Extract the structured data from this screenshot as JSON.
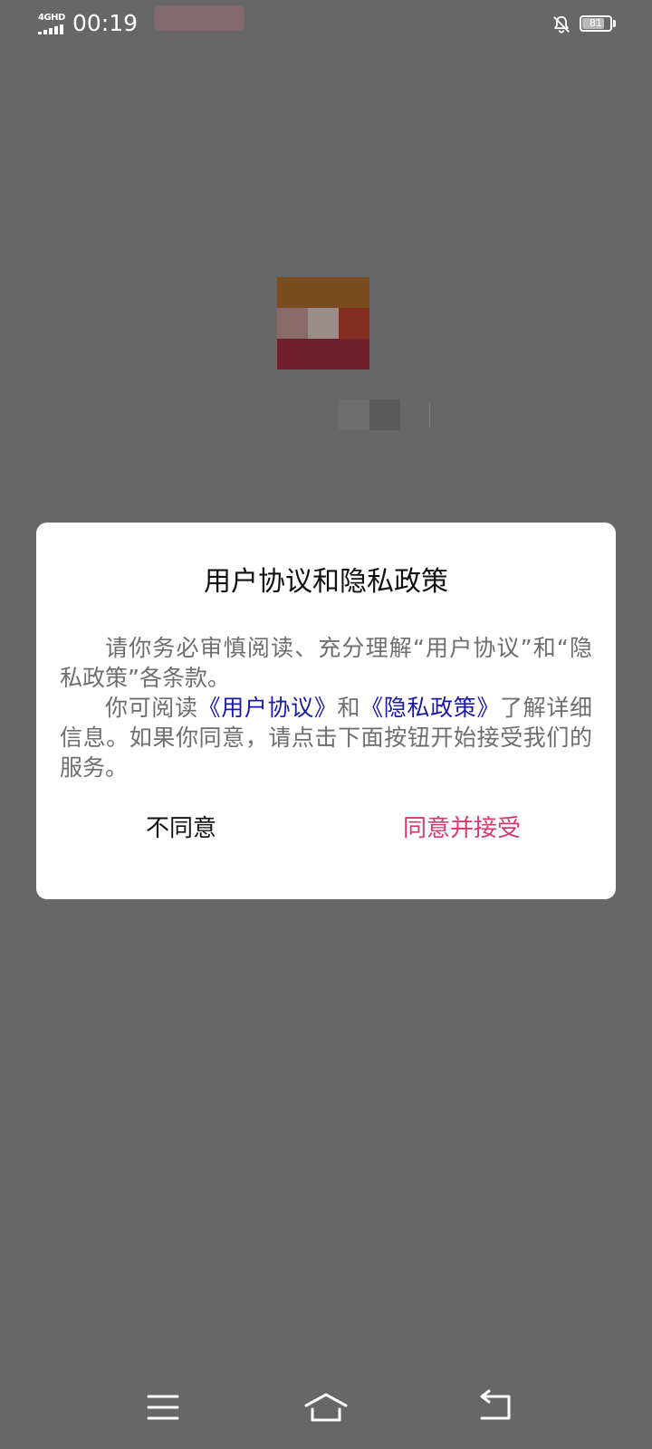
{
  "status_bar": {
    "network": "4GHD",
    "time": "00:19",
    "battery_level": 81,
    "icons": [
      "signal-icon",
      "bell-off-icon",
      "battery-icon"
    ]
  },
  "dialog": {
    "title": "用户协议和隐私政策",
    "paragraph1": "请你务必审慎阅读、充分理解“用户协议”和“隐私政策”各条款。",
    "paragraph2_prefix": "你可阅读",
    "user_agreement_link": "《用户协议》",
    "paragraph2_and": "和",
    "privacy_policy_link": "《隐私政策》",
    "paragraph2_suffix": "了解详细信息。如果你同意，请点击下面按钮开始接受我们的服务。",
    "disagree_label": "不同意",
    "agree_label": "同意并接受"
  },
  "navigation": {
    "icons": [
      "menu-icon",
      "home-icon",
      "back-icon"
    ]
  },
  "colors": {
    "overlay": "#676767",
    "link": "#1a1aa6",
    "accent": "#d63a6d"
  }
}
